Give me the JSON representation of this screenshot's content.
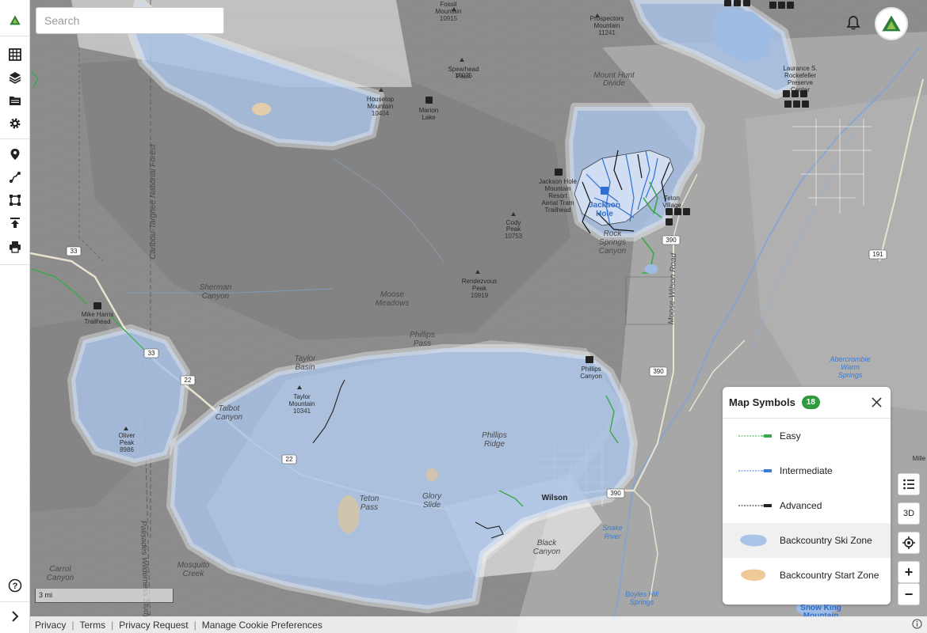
{
  "search": {
    "placeholder": "Search"
  },
  "sidebar": {
    "items": [
      {
        "name": "grid-icon"
      },
      {
        "name": "layers-icon"
      },
      {
        "name": "folder-icon"
      },
      {
        "name": "gear-icon"
      },
      {
        "name": "location-pin-icon"
      },
      {
        "name": "route-icon"
      },
      {
        "name": "polygon-icon"
      },
      {
        "name": "upload-icon"
      },
      {
        "name": "print-icon"
      }
    ],
    "help": "help-icon",
    "expand": "chevron-right-icon"
  },
  "map_controls": {
    "three_d": "3D",
    "zoom_in": "+",
    "zoom_out": "−"
  },
  "legend": {
    "title": "Map Symbols",
    "count": "18",
    "items": [
      {
        "label": "Easy",
        "symbol": "easy-trail",
        "color": "#3aa84a"
      },
      {
        "label": "Intermediate",
        "symbol": "intermediate-trail",
        "color": "#3a7bd5"
      },
      {
        "label": "Advanced",
        "symbol": "advanced-trail",
        "color": "#222222"
      },
      {
        "label": "Backcountry Ski Zone",
        "symbol": "ski-zone",
        "color": "#aac4e8"
      },
      {
        "label": "Backcountry Start Zone",
        "symbol": "start-zone",
        "color": "#f0c998"
      }
    ]
  },
  "scale": {
    "label": "3 mi"
  },
  "footer": {
    "links": [
      "Privacy",
      "Terms",
      "Privacy Request",
      "Manage Cookie Preferences"
    ]
  },
  "map": {
    "labels": {
      "fossil": "Fossil\nMountain",
      "spearhead": "Spearhead\nPeak",
      "prospectors": "Prospectors\nMountain",
      "mount_hunt": "Mount Hunt",
      "divide": "Divide",
      "housetop": "Housetop\nMountain",
      "marion_lake": "Marion\nLake",
      "laurance": "Laurance S.",
      "rockefeller": "Rockefeller",
      "preserve": "Preserve",
      "center": "Center",
      "jh_resort_1": "Jackson Hole",
      "jh_resort_2": "Mountain",
      "jh_resort_3": "Resort",
      "aerial_tram": "Aerial Tram",
      "trailhead": "Trailhead",
      "jackson": "Jackson",
      "hole": "Hole",
      "teton": "Teton",
      "village": "Village",
      "cody_peak": "Cody",
      "peak": "Peak",
      "rock": "Rock",
      "springs": "Springs",
      "canyon": "Canyon",
      "sherman": "Sherman",
      "sherman_canyon": "Canyon",
      "rendezvous": "Rendezvous",
      "rendezvous_peak": "Peak",
      "moose": "Moose",
      "meadows": "Meadows",
      "mike_harris": "Mike Harris",
      "mh_trailhead": "Trailhead",
      "phillips": "Phillips",
      "pass": "Pass",
      "taylor": "Taylor",
      "basin": "Basin",
      "taylor_mtn": "Taylor",
      "mountain": "Mountain",
      "phillips_canyon_1": "Phillips",
      "phillips_canyon_2": "Canyon",
      "talbot": "Talbot",
      "talbot_canyon": "Canyon",
      "oliver": "Oliver",
      "oliver_peak": "Peak",
      "phillips_ridge_1": "Phillips",
      "phillips_ridge_2": "Ridge",
      "teton_pass_1": "Teton",
      "teton_pass_2": "Pass",
      "glory_1": "Glory",
      "glory_2": "Slide",
      "wilson": "Wilson",
      "black": "Black",
      "black_canyon": "Canyon",
      "snake": "Snake",
      "river": "River",
      "carrol": "Carrol",
      "carrol_canyon": "Canyon",
      "mosquito": "Mosquito",
      "mosquito_creek": "Creek",
      "abercrombie": "Abercrombie",
      "warm": "Warm",
      "springs2": "Springs",
      "boyles": "Boyles Hill",
      "springs3": "Springs",
      "snow_king_1": "Snow King",
      "snow_king_2": "Mountain",
      "moose_wilson": "Moose-Wilson Road",
      "caribou": "Caribou-Targhee National Forest",
      "palisades": "Palisades Wilderness Study",
      "mille": "Mille"
    },
    "elevations": {
      "fossil": "10915",
      "spearhead": "10075",
      "prospectors": "11241",
      "housetop": "10404",
      "cody": "10753",
      "rendezvous": "10919",
      "taylor": "10341",
      "oliver": "8986"
    },
    "route_shields": {
      "r33a": "33",
      "r33b": "33",
      "r22a": "22",
      "r22b": "22",
      "r390a": "390",
      "r390b": "390",
      "r390c": "390",
      "r191": "191"
    }
  }
}
